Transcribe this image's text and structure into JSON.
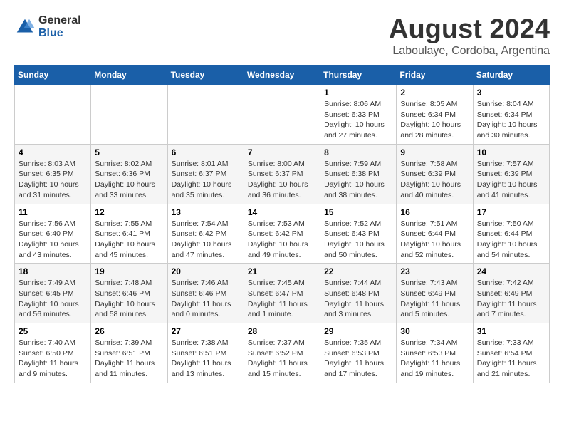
{
  "header": {
    "logo_general": "General",
    "logo_blue": "Blue",
    "month_title": "August 2024",
    "location": "Laboulaye, Cordoba, Argentina"
  },
  "weekdays": [
    "Sunday",
    "Monday",
    "Tuesday",
    "Wednesday",
    "Thursday",
    "Friday",
    "Saturday"
  ],
  "weeks": [
    [
      {
        "day": "",
        "info": ""
      },
      {
        "day": "",
        "info": ""
      },
      {
        "day": "",
        "info": ""
      },
      {
        "day": "",
        "info": ""
      },
      {
        "day": "1",
        "info": "Sunrise: 8:06 AM\nSunset: 6:33 PM\nDaylight: 10 hours\nand 27 minutes."
      },
      {
        "day": "2",
        "info": "Sunrise: 8:05 AM\nSunset: 6:34 PM\nDaylight: 10 hours\nand 28 minutes."
      },
      {
        "day": "3",
        "info": "Sunrise: 8:04 AM\nSunset: 6:34 PM\nDaylight: 10 hours\nand 30 minutes."
      }
    ],
    [
      {
        "day": "4",
        "info": "Sunrise: 8:03 AM\nSunset: 6:35 PM\nDaylight: 10 hours\nand 31 minutes."
      },
      {
        "day": "5",
        "info": "Sunrise: 8:02 AM\nSunset: 6:36 PM\nDaylight: 10 hours\nand 33 minutes."
      },
      {
        "day": "6",
        "info": "Sunrise: 8:01 AM\nSunset: 6:37 PM\nDaylight: 10 hours\nand 35 minutes."
      },
      {
        "day": "7",
        "info": "Sunrise: 8:00 AM\nSunset: 6:37 PM\nDaylight: 10 hours\nand 36 minutes."
      },
      {
        "day": "8",
        "info": "Sunrise: 7:59 AM\nSunset: 6:38 PM\nDaylight: 10 hours\nand 38 minutes."
      },
      {
        "day": "9",
        "info": "Sunrise: 7:58 AM\nSunset: 6:39 PM\nDaylight: 10 hours\nand 40 minutes."
      },
      {
        "day": "10",
        "info": "Sunrise: 7:57 AM\nSunset: 6:39 PM\nDaylight: 10 hours\nand 41 minutes."
      }
    ],
    [
      {
        "day": "11",
        "info": "Sunrise: 7:56 AM\nSunset: 6:40 PM\nDaylight: 10 hours\nand 43 minutes."
      },
      {
        "day": "12",
        "info": "Sunrise: 7:55 AM\nSunset: 6:41 PM\nDaylight: 10 hours\nand 45 minutes."
      },
      {
        "day": "13",
        "info": "Sunrise: 7:54 AM\nSunset: 6:42 PM\nDaylight: 10 hours\nand 47 minutes."
      },
      {
        "day": "14",
        "info": "Sunrise: 7:53 AM\nSunset: 6:42 PM\nDaylight: 10 hours\nand 49 minutes."
      },
      {
        "day": "15",
        "info": "Sunrise: 7:52 AM\nSunset: 6:43 PM\nDaylight: 10 hours\nand 50 minutes."
      },
      {
        "day": "16",
        "info": "Sunrise: 7:51 AM\nSunset: 6:44 PM\nDaylight: 10 hours\nand 52 minutes."
      },
      {
        "day": "17",
        "info": "Sunrise: 7:50 AM\nSunset: 6:44 PM\nDaylight: 10 hours\nand 54 minutes."
      }
    ],
    [
      {
        "day": "18",
        "info": "Sunrise: 7:49 AM\nSunset: 6:45 PM\nDaylight: 10 hours\nand 56 minutes."
      },
      {
        "day": "19",
        "info": "Sunrise: 7:48 AM\nSunset: 6:46 PM\nDaylight: 10 hours\nand 58 minutes."
      },
      {
        "day": "20",
        "info": "Sunrise: 7:46 AM\nSunset: 6:46 PM\nDaylight: 11 hours\nand 0 minutes."
      },
      {
        "day": "21",
        "info": "Sunrise: 7:45 AM\nSunset: 6:47 PM\nDaylight: 11 hours\nand 1 minute."
      },
      {
        "day": "22",
        "info": "Sunrise: 7:44 AM\nSunset: 6:48 PM\nDaylight: 11 hours\nand 3 minutes."
      },
      {
        "day": "23",
        "info": "Sunrise: 7:43 AM\nSunset: 6:49 PM\nDaylight: 11 hours\nand 5 minutes."
      },
      {
        "day": "24",
        "info": "Sunrise: 7:42 AM\nSunset: 6:49 PM\nDaylight: 11 hours\nand 7 minutes."
      }
    ],
    [
      {
        "day": "25",
        "info": "Sunrise: 7:40 AM\nSunset: 6:50 PM\nDaylight: 11 hours\nand 9 minutes."
      },
      {
        "day": "26",
        "info": "Sunrise: 7:39 AM\nSunset: 6:51 PM\nDaylight: 11 hours\nand 11 minutes."
      },
      {
        "day": "27",
        "info": "Sunrise: 7:38 AM\nSunset: 6:51 PM\nDaylight: 11 hours\nand 13 minutes."
      },
      {
        "day": "28",
        "info": "Sunrise: 7:37 AM\nSunset: 6:52 PM\nDaylight: 11 hours\nand 15 minutes."
      },
      {
        "day": "29",
        "info": "Sunrise: 7:35 AM\nSunset: 6:53 PM\nDaylight: 11 hours\nand 17 minutes."
      },
      {
        "day": "30",
        "info": "Sunrise: 7:34 AM\nSunset: 6:53 PM\nDaylight: 11 hours\nand 19 minutes."
      },
      {
        "day": "31",
        "info": "Sunrise: 7:33 AM\nSunset: 6:54 PM\nDaylight: 11 hours\nand 21 minutes."
      }
    ]
  ]
}
